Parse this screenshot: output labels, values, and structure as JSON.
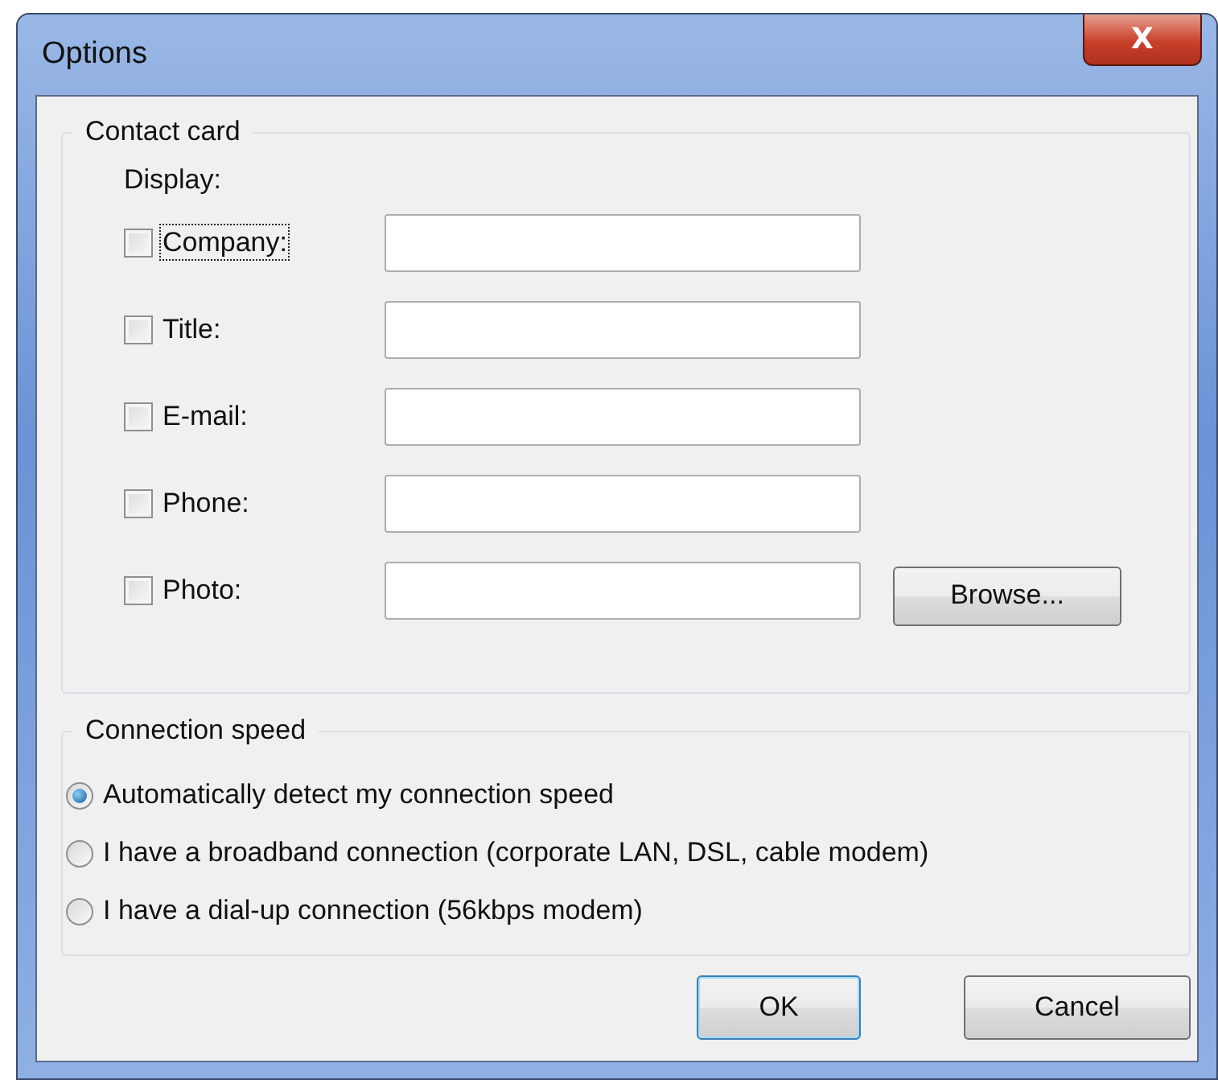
{
  "window": {
    "title": "Options",
    "close_label": "X"
  },
  "contact_card": {
    "title": "Contact card",
    "display_label": "Display:",
    "items": [
      {
        "label": "Company:",
        "checked": false,
        "focused": true,
        "value": ""
      },
      {
        "label": "Title:",
        "checked": false,
        "focused": false,
        "value": ""
      },
      {
        "label": "E-mail:",
        "checked": false,
        "focused": false,
        "value": ""
      },
      {
        "label": "Phone:",
        "checked": false,
        "focused": false,
        "value": ""
      },
      {
        "label": "Photo:",
        "checked": false,
        "focused": false,
        "value": "",
        "button": "Browse..."
      }
    ]
  },
  "connection_speed": {
    "title": "Connection speed",
    "options": [
      {
        "label": "Automatically detect my connection speed",
        "selected": true
      },
      {
        "label": "I have a broadband connection (corporate LAN, DSL, cable modem)",
        "selected": false
      },
      {
        "label": "I have a dial-up connection (56kbps modem)",
        "selected": false
      }
    ]
  },
  "buttons": [
    {
      "label": "OK",
      "default": true
    },
    {
      "label": "Cancel",
      "default": false
    }
  ]
}
